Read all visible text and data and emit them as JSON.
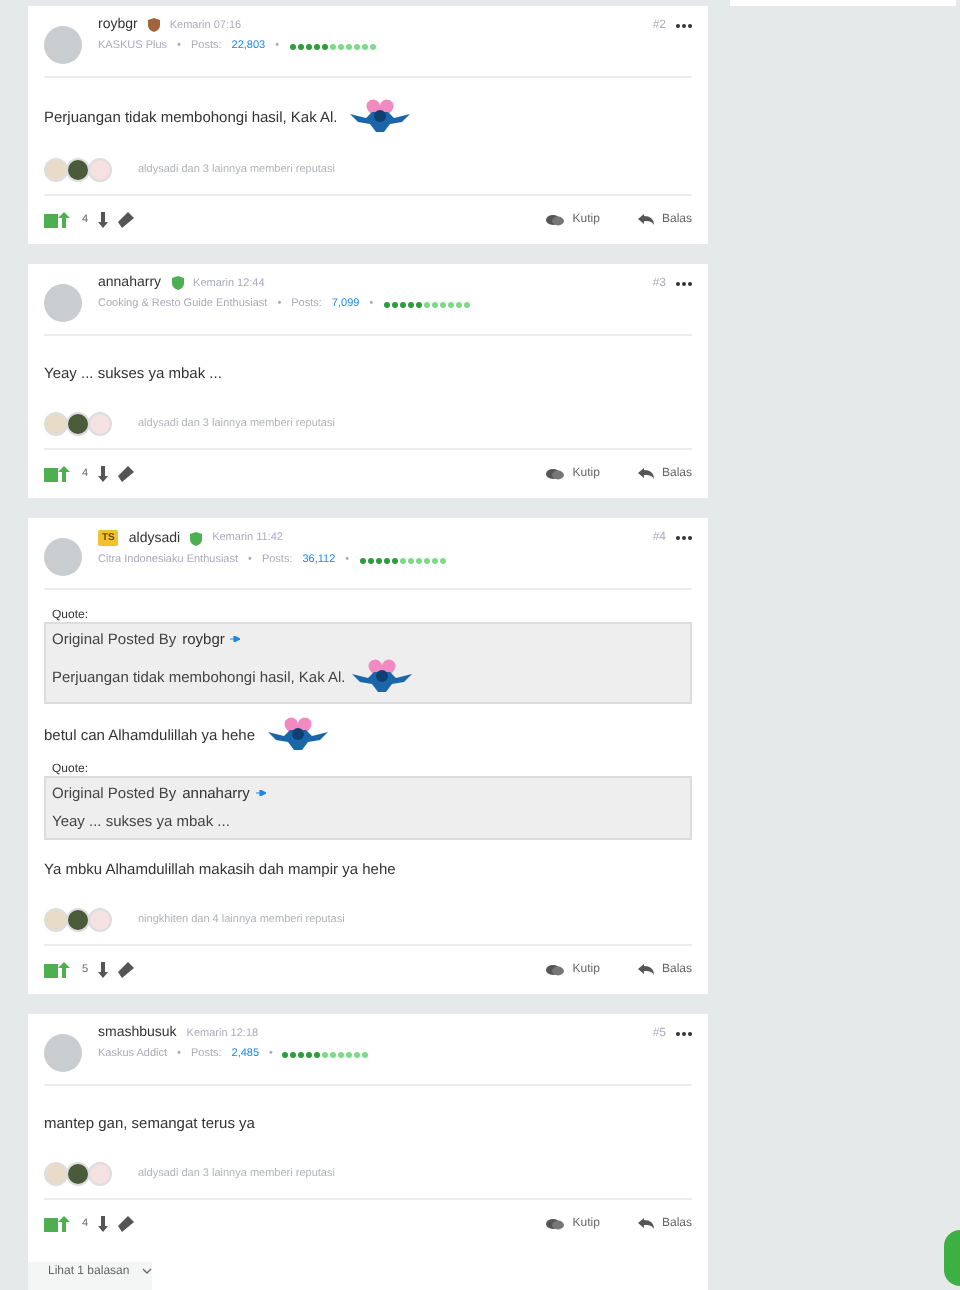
{
  "posts": [
    {
      "username": "roybgr",
      "badge": {
        "color": "#a0653a"
      },
      "time": "Kemarin 07:16",
      "rank": "KASKUS Plus",
      "separator": "•",
      "posts_label": "Posts:",
      "posts_count": "22,803",
      "level": 0.45,
      "number": "#2",
      "body": [
        {
          "kind": "text",
          "text": "Perjuangan tidak membohongi hasil, Kak Al.",
          "sticker": true
        }
      ],
      "reputation": "aldysadi dan 3 lainnya memberi reputasi",
      "votes": "4",
      "quote_label": "Kutip",
      "reply_label": "Balas"
    },
    {
      "username": "annaharry",
      "badge": {
        "color": "#4caf50"
      },
      "time": "Kemarin 12:44",
      "rank": "Cooking & Resto Guide Enthusiast",
      "separator": "•",
      "posts_label": "Posts:",
      "posts_count": "7,099",
      "level": 0.45,
      "number": "#3",
      "body": [
        {
          "kind": "text",
          "text": "Yeay ... sukses ya mbak ...",
          "sticker": false
        }
      ],
      "reputation": "aldysadi dan 3 lainnya memberi reputasi",
      "votes": "4",
      "quote_label": "Kutip",
      "reply_label": "Balas"
    },
    {
      "username": "aldysadi",
      "ts": "TS",
      "badge": {
        "color": "#4caf50"
      },
      "time": "Kemarin 11:42",
      "rank": "Citra Indonesiaku Enthusiast",
      "separator": "•",
      "posts_label": "Posts:",
      "posts_count": "36,112",
      "level": 0.45,
      "number": "#4",
      "body": [
        {
          "kind": "quote",
          "label": "Quote:",
          "prefix": "Original Posted By",
          "author": "roybgr",
          "text": "Perjuangan tidak membohongi hasil, Kak Al.",
          "sticker": true
        },
        {
          "kind": "text",
          "text": "betul can Alhamdulillah ya hehe",
          "sticker": true
        },
        {
          "kind": "quote",
          "label": "Quote:",
          "prefix": "Original Posted By",
          "author": "annaharry",
          "text": "Yeay ... sukses ya mbak ...",
          "sticker": false
        },
        {
          "kind": "text",
          "text": "Ya mbku Alhamdulillah makasih dah mampir ya hehe",
          "sticker": false
        }
      ],
      "reputation": "ningkhiten dan 4 lainnya memberi reputasi",
      "votes": "5",
      "quote_label": "Kutip",
      "reply_label": "Balas"
    },
    {
      "username": "smashbusuk",
      "time": "Kemarin 12:18",
      "rank": "Kaskus Addict",
      "separator": "•",
      "posts_label": "Posts:",
      "posts_count": "2,485",
      "level": 0.45,
      "number": "#5",
      "body": [
        {
          "kind": "text",
          "text": "mantep gan, semangat terus ya",
          "sticker": false
        }
      ],
      "reputation": "aldysadi dan 3 lainnya memberi reputasi",
      "votes": "4",
      "quote_label": "Kutip",
      "reply_label": "Balas",
      "more_replies": "Lihat 1 balasan"
    }
  ]
}
